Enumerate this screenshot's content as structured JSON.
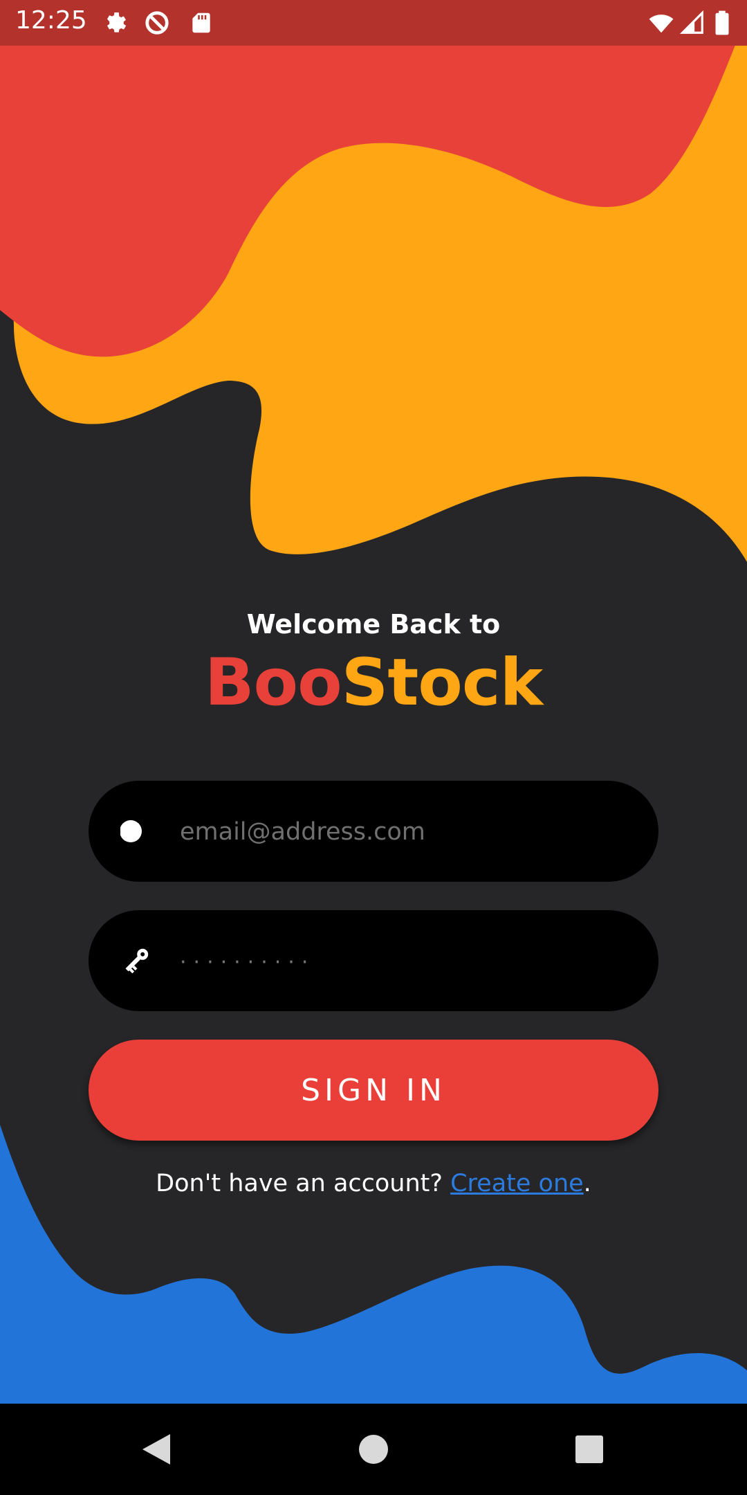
{
  "status_bar": {
    "time": "12:25",
    "left_icons": [
      "gear-icon",
      "sync-off-icon",
      "sd-card-icon"
    ],
    "right_icons": [
      "wifi-icon",
      "cell-signal-icon",
      "battery-icon"
    ]
  },
  "colors": {
    "background": "#262628",
    "red": "#e8413a",
    "orange": "#ffa615",
    "blue": "#2274d9",
    "status_bar": "#b3322c",
    "link": "#2b7be0"
  },
  "header": {
    "welcome": "Welcome Back to",
    "brand_part1": "Boo",
    "brand_part2": "Stock"
  },
  "form": {
    "email_placeholder": "email@address.com",
    "email_value": "",
    "password_placeholder": "··········",
    "password_value": "",
    "email_icon": "dot-icon",
    "password_icon": "key-icon",
    "submit_label": "SIGN IN"
  },
  "signup": {
    "prefix": "Don't have an account?",
    "link": "Create one",
    "suffix": "."
  },
  "nav_bar": {
    "buttons": [
      "back-icon",
      "home-icon",
      "recents-icon"
    ]
  }
}
